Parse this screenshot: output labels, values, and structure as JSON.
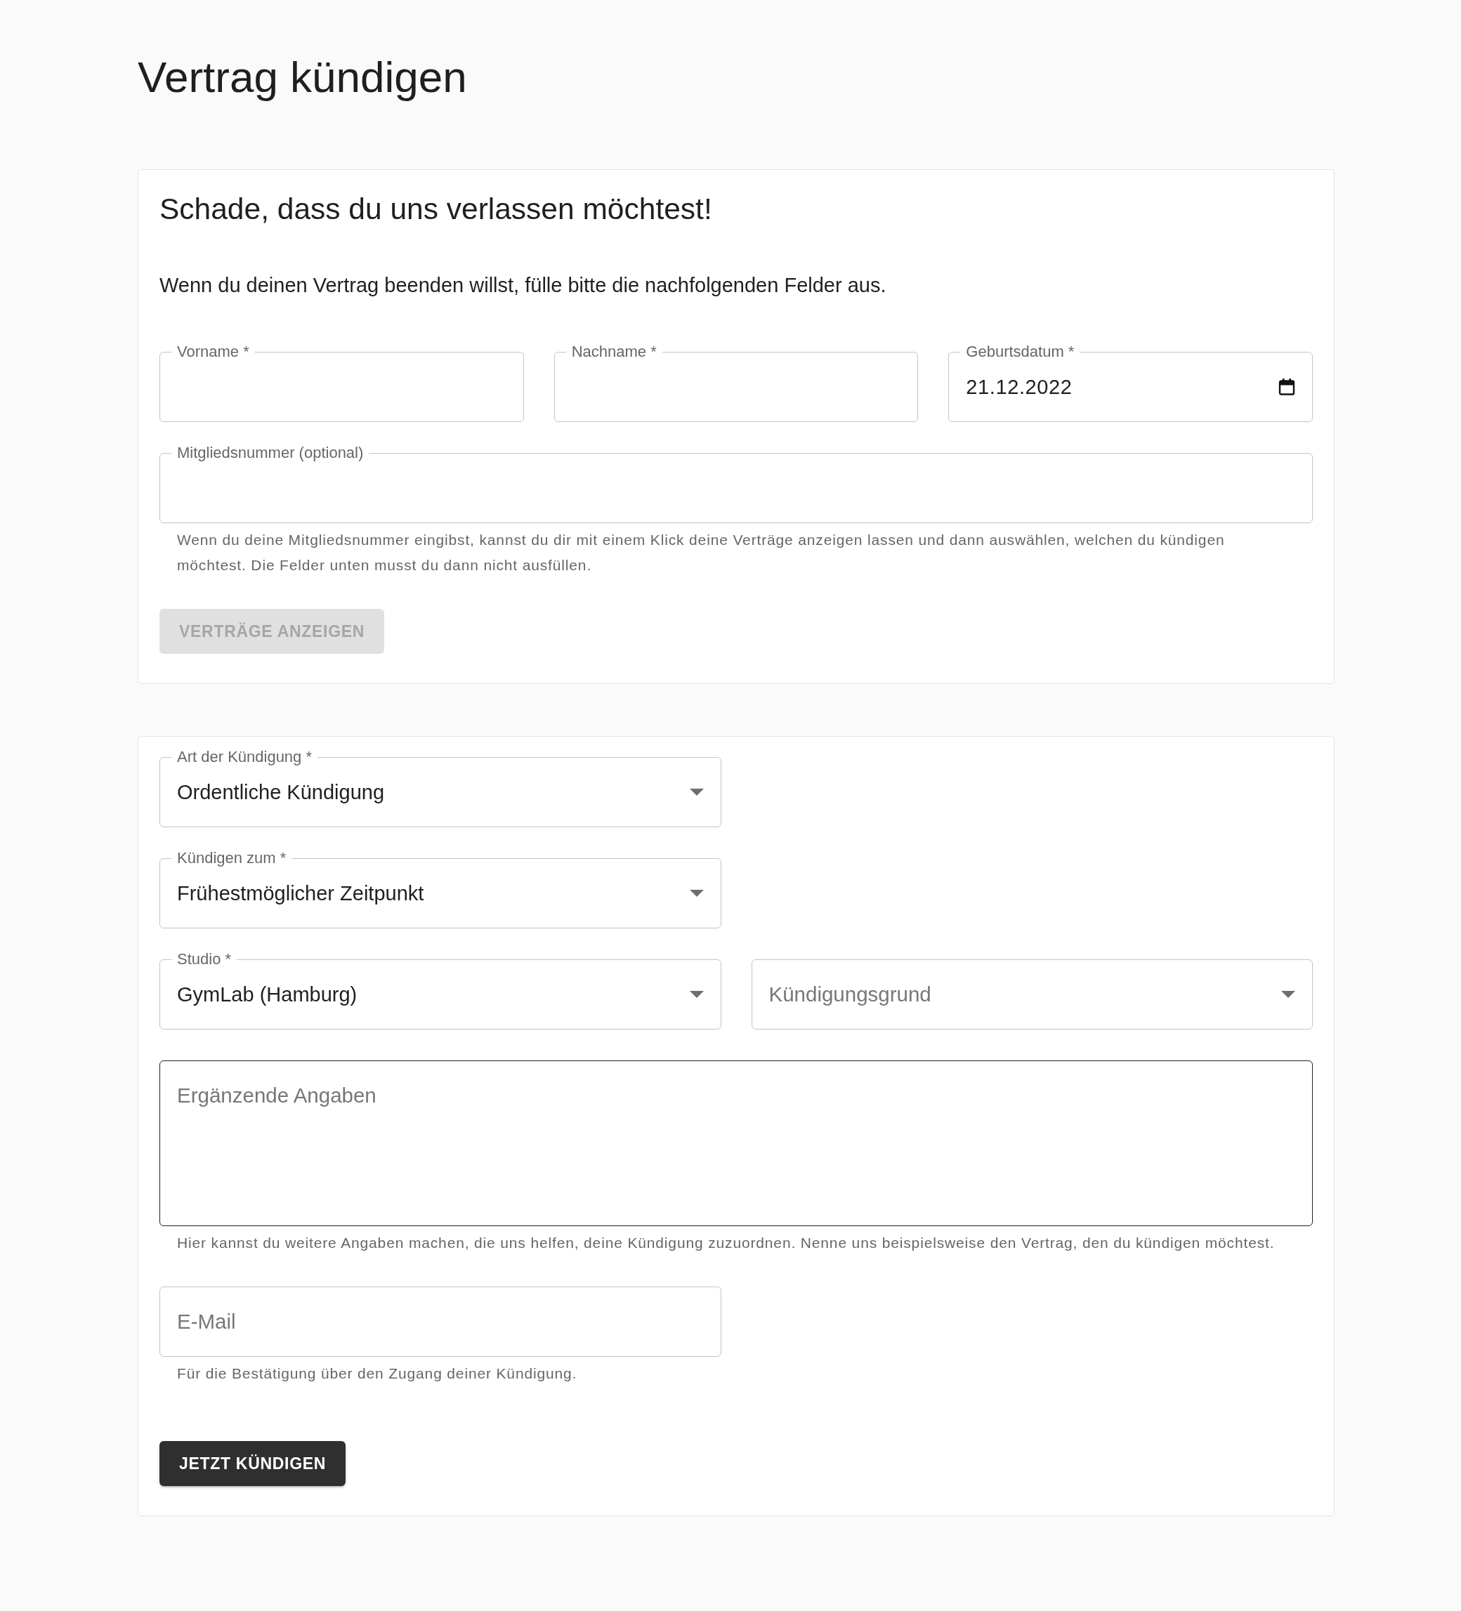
{
  "page": {
    "title": "Vertrag kündigen"
  },
  "intro_card": {
    "heading": "Schade, dass du uns verlassen möchtest!",
    "text": "Wenn du deinen Vertrag beenden willst, fülle bitte die nachfolgenden Felder aus.",
    "name_row": [
      {
        "kind": "text",
        "label": "Vorname *",
        "hovered": false
      },
      {
        "kind": "text",
        "label": "Nachname *",
        "hovered": false
      },
      {
        "kind": "date",
        "label": "Geburtsdatum *",
        "value": "21.12.2022",
        "hovered": false
      }
    ],
    "member_field": {
      "kind": "text",
      "label": "Mitgliedsnummer (optional)",
      "helper": "Wenn du deine Mitgliedsnummer eingibst, kannst du dir mit einem Klick deine Verträge anzeigen lassen und dann auswählen, welchen du kündigen möchtest. Die Felder unten musst du dann nicht ausfüllen.",
      "hovered": false
    },
    "button": {
      "label": "VERTRÄGE ANZEIGEN",
      "disabled": true
    }
  },
  "contract_card": {
    "rows": [
      [
        {
          "kind": "select",
          "label": "Art der Kündigung *",
          "value": "Ordentliche Kündigung",
          "hovered": false
        }
      ],
      [
        {
          "kind": "select",
          "label": "Kündigen zum *",
          "value": "Frühestmöglicher Zeitpunkt",
          "hovered": false
        }
      ],
      [
        {
          "kind": "select",
          "label": "Studio *",
          "value": "GymLab (Hamburg)",
          "hovered": false
        },
        {
          "kind": "select",
          "placeholder": "Kündigungsgrund",
          "hovered": false
        }
      ],
      [
        {
          "kind": "textarea",
          "placeholder": "Ergänzende Angaben",
          "helper": "Hier kannst du weitere Angaben machen, die uns helfen, deine Kündigung zuzuordnen. Nenne uns beispielsweise den Vertrag, den du kündigen möchtest.",
          "hovered": true
        }
      ],
      [
        {
          "kind": "text",
          "placeholder": "E-Mail",
          "helper": "Für die Bestätigung über den Zugang deiner Kündigung.",
          "hovered": false
        }
      ]
    ],
    "button": {
      "label": "JETZT KÜNDIGEN",
      "disabled": false
    }
  }
}
